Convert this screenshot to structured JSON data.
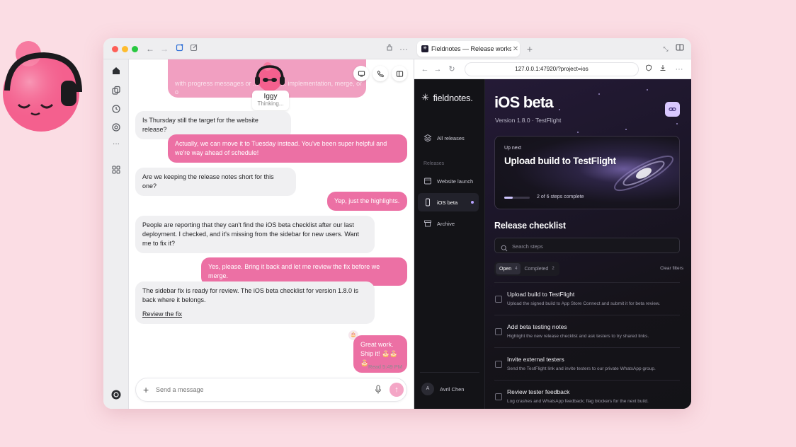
{
  "mascot": {
    "icon": "headphone-mascot-icon"
  },
  "window": {
    "titlebar": {
      "traffic_lights": [
        "#fe5f57",
        "#febc2e",
        "#28c840"
      ],
      "tab_title": "Fieldnotes — Release worksp",
      "tab_icon": "fieldnotes-favicon"
    }
  },
  "chat": {
    "top_preview": "with progress messages or ... in-chat ... implementation, merge, or o",
    "agent": {
      "name": "Iggy",
      "status": "Thinking..."
    },
    "messages": [
      {
        "from": "assistant",
        "text": "Is Thursday still the target for the website release?"
      },
      {
        "from": "user",
        "text": "Actually, we can move it to Tuesday instead. You've been super helpful and we're way ahead of schedule!"
      },
      {
        "from": "assistant",
        "text": "Are we keeping the release notes short for this one?"
      },
      {
        "from": "user",
        "text": "Yep, just the highlights."
      },
      {
        "from": "assistant",
        "text": "People are reporting that they can't find the iOS beta checklist after our last deployment. I checked, and it's missing from the sidebar for new users. Want me to fix it?"
      },
      {
        "from": "user",
        "text": "Yes, please. Bring it back and let me review the fix before we merge."
      },
      {
        "from": "assistant",
        "text": "The sidebar fix is ready for review. The iOS beta checklist for version 1.8.0 is back where it belongs.",
        "link": "Review the fix"
      },
      {
        "from": "user",
        "text": "Great work. Ship it! 🎂🎂🎂"
      }
    ],
    "read_receipt": "Read 5:49 PM",
    "composer": {
      "placeholder": "Send a message"
    },
    "accent": "#ec70a4"
  },
  "browser": {
    "url": "127.0.0.1:47920/?project=ios"
  },
  "app": {
    "brand": "fieldnotes.",
    "nav": {
      "all_releases": "All releases",
      "section": "Releases",
      "items": [
        "Website launch",
        "iOS beta",
        "Archive"
      ]
    },
    "user": {
      "initial": "A",
      "name": "Avril Chen"
    },
    "project": {
      "title": "iOS beta",
      "subtitle": "Version 1.8.0 · TestFlight"
    },
    "up_next": {
      "label": "Up next",
      "title": "Upload build to TestFlight",
      "progress_text": "2 of 6 steps complete",
      "progress_fraction": 0.33
    },
    "checklist": {
      "title": "Release checklist",
      "search_placeholder": "Search steps",
      "filters": [
        {
          "label": "Open",
          "count": "4"
        },
        {
          "label": "Completed",
          "count": "2"
        }
      ],
      "clear": "Clear filters",
      "steps": [
        {
          "title": "Upload build to TestFlight",
          "desc": "Upload the signed build to App Store Connect and submit it for beta review."
        },
        {
          "title": "Add beta testing notes",
          "desc": "Highlight the new release checklist and ask testers to try shared links."
        },
        {
          "title": "Invite external testers",
          "desc": "Send the TestFlight link and invite testers to our private WhatsApp group."
        },
        {
          "title": "Review tester feedback",
          "desc": "Log crashes and WhatsApp feedback; flag blockers for the next build."
        }
      ]
    }
  }
}
